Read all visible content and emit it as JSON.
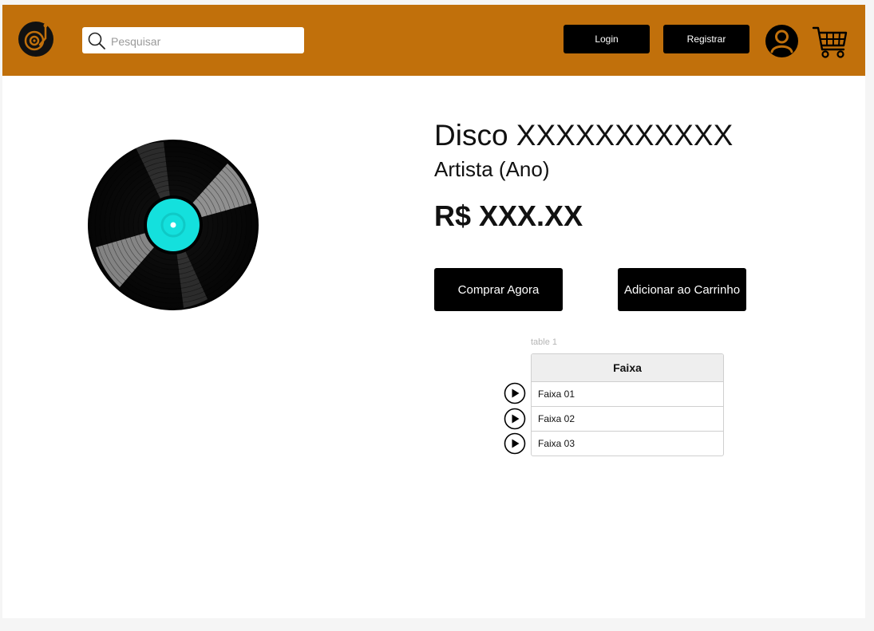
{
  "header": {
    "search_placeholder": "Pesquisar",
    "login_label": "Login",
    "register_label": "Registrar"
  },
  "product": {
    "title": "Disco XXXXXXXXXXX",
    "artist": "Artista (Ano)",
    "price": "R$ XXX.XX",
    "buy_label": "Comprar Agora",
    "add_to_cart_label": "Adicionar ao Carrinho"
  },
  "tracks": {
    "caption": "table 1",
    "header": "Faixa",
    "rows": [
      {
        "name": "Faixa 01"
      },
      {
        "name": "Faixa 02"
      },
      {
        "name": "Faixa 03"
      }
    ]
  },
  "icons": {
    "logo": "turntable-logo-icon",
    "search": "search-icon",
    "user": "user-icon",
    "cart": "shopping-cart-icon",
    "play": "play-icon",
    "album": "vinyl-record-image"
  },
  "colors": {
    "header_bg": "#c1700b",
    "button_bg": "#000000",
    "vinyl_label": "#14e0dd"
  }
}
